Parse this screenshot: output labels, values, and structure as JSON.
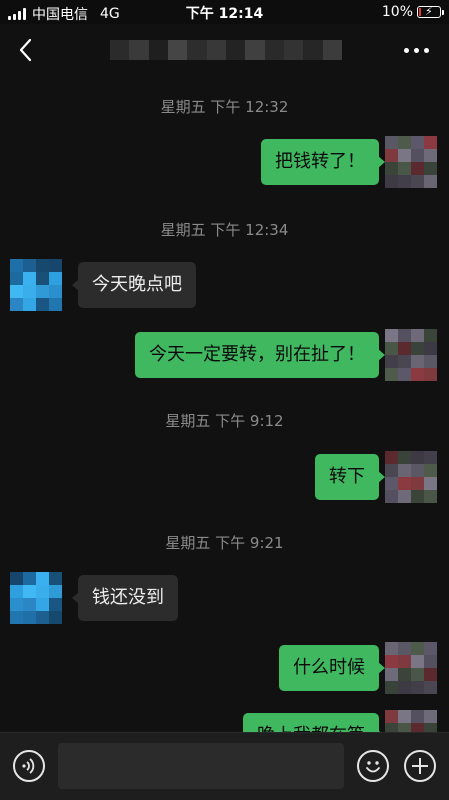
{
  "status_bar": {
    "carrier": "中国电信",
    "network": "4G",
    "time": "下午 12:14",
    "battery": "10%",
    "battery_level": 0.1,
    "signal_icon": "signal-bars-icon",
    "battery_icon": "battery-charging-icon"
  },
  "nav": {
    "back_icon": "chevron-left-icon",
    "title": "",
    "more_icon": "more-dots-icon"
  },
  "messages": [
    {
      "type": "time",
      "text": "星期五 下午 12:32"
    },
    {
      "type": "out",
      "text": "把钱转了！"
    },
    {
      "type": "time",
      "text": "星期五 下午 12:34"
    },
    {
      "type": "in",
      "text": "今天晚点吧"
    },
    {
      "type": "out",
      "text": "今天一定要转，别在扯了！"
    },
    {
      "type": "time",
      "text": "星期五 下午 9:12"
    },
    {
      "type": "out",
      "text": "转下"
    },
    {
      "type": "time",
      "text": "星期五 下午 9:21"
    },
    {
      "type": "in",
      "text": "钱还没到"
    },
    {
      "type": "out",
      "text": "什么时候"
    },
    {
      "type": "out",
      "text": "晚上我都在等"
    }
  ],
  "input_bar": {
    "voice_icon": "voice-icon",
    "placeholder": "",
    "emoji_icon": "emoji-icon",
    "plus_icon": "plus-icon"
  },
  "colors": {
    "outgoing_bubble": "#3fb860",
    "incoming_bubble": "#2c2c2c",
    "background": "#111111",
    "timestamp": "#8a8a8a"
  }
}
